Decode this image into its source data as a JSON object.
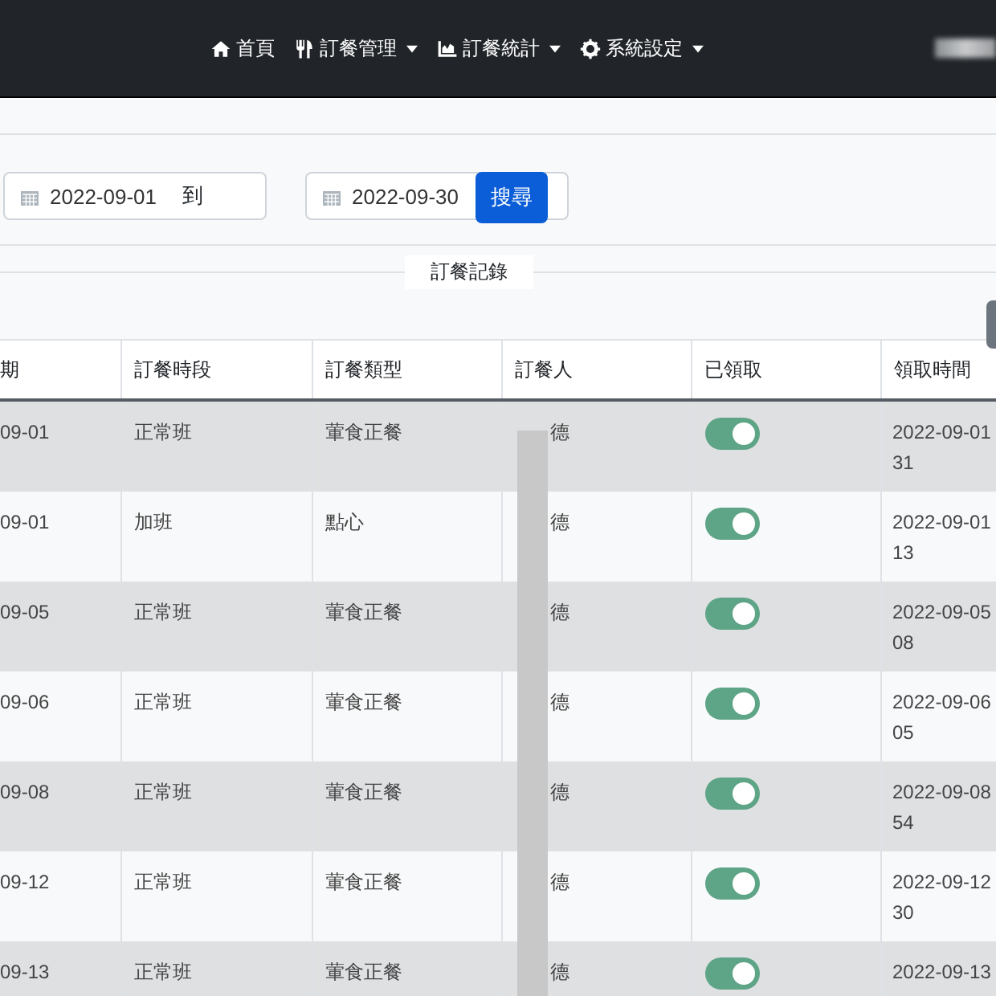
{
  "navbar": {
    "items": [
      {
        "label": "首頁",
        "dropdown": false
      },
      {
        "label": "訂餐管理",
        "dropdown": true
      },
      {
        "label": "訂餐統計",
        "dropdown": true
      },
      {
        "label": "系統設定",
        "dropdown": true
      }
    ]
  },
  "filter": {
    "start_date": "2022-09-01",
    "separator": "到",
    "end_date": "2022-09-30",
    "search_button": "搜尋"
  },
  "section_title": "訂餐記錄",
  "table": {
    "columns": [
      "期",
      "訂餐時段",
      "訂餐類型",
      "訂餐人",
      "已領取",
      "領取時間"
    ],
    "rows": [
      {
        "date": "09-01",
        "period": "正常班",
        "type": "葷食正餐",
        "orderer": "德",
        "picked_up": true,
        "pickup_time": [
          "2022-09-01",
          "31"
        ]
      },
      {
        "date": "09-01",
        "period": "加班",
        "type": "點心",
        "orderer": "德",
        "picked_up": true,
        "pickup_time": [
          "2022-09-01",
          "13"
        ]
      },
      {
        "date": "09-05",
        "period": "正常班",
        "type": "葷食正餐",
        "orderer": "德",
        "picked_up": true,
        "pickup_time": [
          "2022-09-05",
          "08"
        ]
      },
      {
        "date": "09-06",
        "period": "正常班",
        "type": "葷食正餐",
        "orderer": "德",
        "picked_up": true,
        "pickup_time": [
          "2022-09-06",
          "05"
        ]
      },
      {
        "date": "09-08",
        "period": "正常班",
        "type": "葷食正餐",
        "orderer": "德",
        "picked_up": true,
        "pickup_time": [
          "2022-09-08",
          "54"
        ]
      },
      {
        "date": "09-12",
        "period": "正常班",
        "type": "葷食正餐",
        "orderer": "德",
        "picked_up": true,
        "pickup_time": [
          "2022-09-12",
          "30"
        ]
      },
      {
        "date": "09-13",
        "period": "正常班",
        "type": "葷食正餐",
        "orderer": "德",
        "picked_up": true,
        "pickup_time": [
          "2022-09-13"
        ]
      }
    ]
  }
}
